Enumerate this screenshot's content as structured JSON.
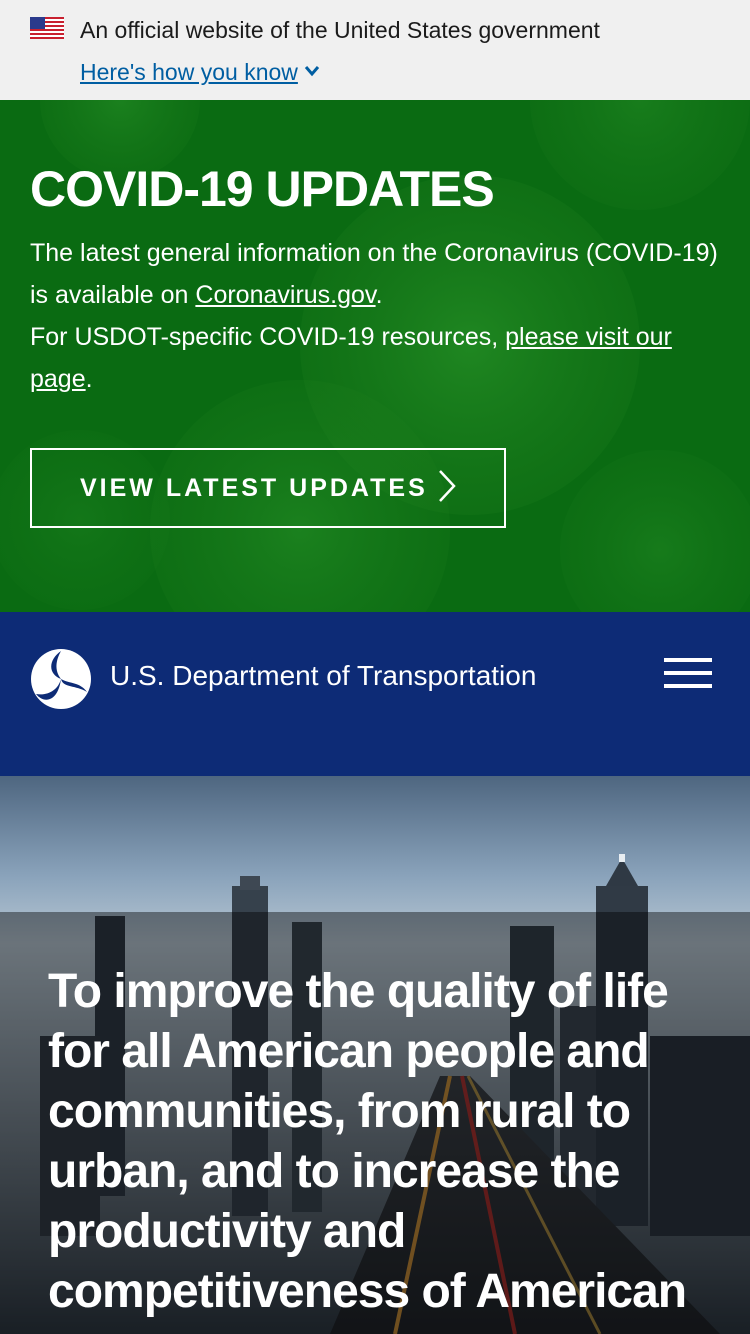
{
  "gov_banner": {
    "official_text": "An official website of the United States government",
    "how_you_know_link": "Here's how you know"
  },
  "covid": {
    "title": "COVID-19 UPDATES",
    "line1_prefix": "The latest general information on the Coronavirus (COVID-19) is available on ",
    "line1_link": "Coronavirus.gov",
    "line1_suffix": ".",
    "line2_prefix": "For USDOT-specific COVID-19 resources, ",
    "line2_link": "please visit our page",
    "line2_suffix": ".",
    "button_label": "VIEW LATEST UPDATES",
    "bg_color": "#0a6b12"
  },
  "header": {
    "site_name": "U.S. Department of Transportation",
    "logo_icon": "dot-tri-star-logo",
    "menu_icon": "hamburger-menu-icon",
    "bg_color": "#0d2b76"
  },
  "hero": {
    "mission_text": "To improve the quality of life for all American people and communities, from rural to urban, and to increase the productivity and competitiveness of American"
  }
}
